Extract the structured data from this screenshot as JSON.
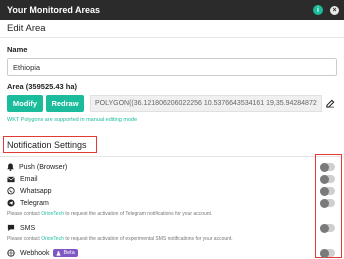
{
  "window": {
    "title": "Your Monitored Areas",
    "info_icon": "i",
    "close_icon": "×"
  },
  "edit_area": {
    "heading": "Edit Area",
    "name_label": "Name",
    "name_value": "Ethiopia",
    "area_label": "Area (359525.43 ha)",
    "modify_label": "Modify",
    "redraw_label": "Redraw",
    "polygon_value": "POLYGON((36.121806206022256 10.5376643534161 19,35.94284872",
    "wkt_note": "WKT Polygons are supported in manual editing mode"
  },
  "notifications": {
    "heading": "Notification Settings",
    "push_label": "Push (Browser)",
    "email_label": "Email",
    "whatsapp_label": "Whatsapp",
    "telegram_label": "Telegram",
    "telegram_note_pre": "Please contact ",
    "telegram_note_link": "OrionTech",
    "telegram_note_post": " to request the activation of Telegram notifications for your account.",
    "sms_label": "SMS",
    "sms_note_pre": "Please contact ",
    "sms_note_link": "OrionTech",
    "sms_note_post": " to request the activation of experimental SMS notifications for your account.",
    "webhook_label": "Webhook",
    "beta_label": "Beta",
    "toggles": {
      "push": false,
      "email": false,
      "whatsapp": false,
      "telegram": false,
      "sms": false,
      "webhook": false
    }
  },
  "colors": {
    "accent": "#1abc9c",
    "highlight": "#e53935",
    "titlebar": "#2b2b2b",
    "beta": "#7e57c2"
  }
}
